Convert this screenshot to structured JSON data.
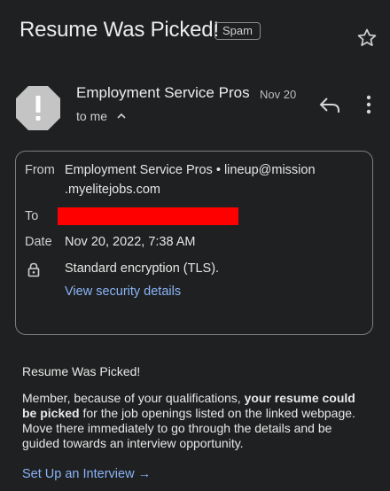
{
  "header": {
    "subject": "Resume Was Picked!",
    "label_chip": "Spam",
    "star_icon": "star-outline-icon"
  },
  "message": {
    "sender_name": "Employment Service Pros",
    "date_short": "Nov 20",
    "to_me": "to me",
    "avatar_icon": "warning-octagon-icon",
    "reply_icon": "reply-icon",
    "more_icon": "more-vert-icon"
  },
  "details": {
    "from_label": "From",
    "from_value_line1": "Employment Service Pros • lineup@mission",
    "from_value_line2": ".myelitejobs.com",
    "to_label": "To",
    "date_label": "Date",
    "date_value": "Nov 20, 2022, 7:38 AM",
    "security_icon": "lock-icon",
    "encryption": "Standard encryption (TLS).",
    "security_link": "View security details"
  },
  "body": {
    "greeting": "Resume Was Picked!",
    "p1_a": "Member, because of your qualifications, ",
    "p1_bold": "your resume could be picked",
    "p1_b": " for the job openings listed on the linked webpage. Move there immediately to go through the details and be guided towards an interview opportunity.",
    "cta": "Set Up an Interview →"
  },
  "colors": {
    "background": "#1f2021",
    "link": "#8ab4f8",
    "redaction": "#ff0000"
  }
}
